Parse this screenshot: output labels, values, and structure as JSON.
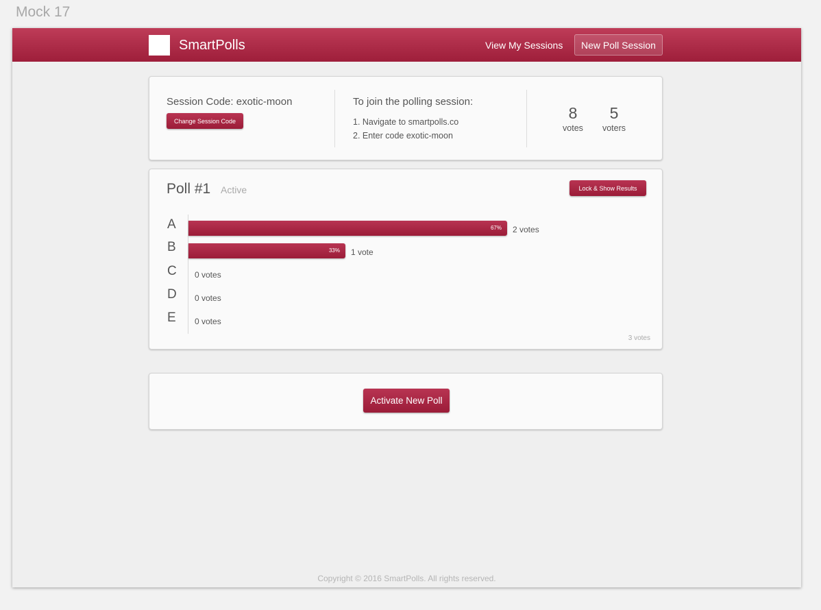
{
  "mock_label": "Mock 17",
  "navbar": {
    "brand": "SmartPolls",
    "view_sessions": "View My Sessions",
    "new_poll_session": "New Poll Session"
  },
  "session": {
    "code_label": "Session Code: exotic-moon",
    "change_button": "Change Session Code",
    "join_title": "To join the polling session:",
    "steps": [
      "1. Navigate to smartpolls.co",
      "2. Enter code exotic-moon"
    ],
    "stats": [
      {
        "value": "8",
        "label": "votes"
      },
      {
        "value": "5",
        "label": "voters"
      }
    ]
  },
  "poll": {
    "title": "Poll #1",
    "status": "Active",
    "lock_button": "Lock & Show Results",
    "options": [
      {
        "letter": "A",
        "percent": 67,
        "percent_label": "67%",
        "votes_label": "2 votes"
      },
      {
        "letter": "B",
        "percent": 33,
        "percent_label": "33%",
        "votes_label": "1 vote"
      },
      {
        "letter": "C",
        "percent": 0,
        "percent_label": "",
        "votes_label": "0 votes"
      },
      {
        "letter": "D",
        "percent": 0,
        "percent_label": "",
        "votes_label": "0 votes"
      },
      {
        "letter": "E",
        "percent": 0,
        "percent_label": "",
        "votes_label": "0 votes"
      }
    ],
    "total_votes": "3 votes"
  },
  "activate_button": "Activate New Poll",
  "footer": "Copyright © 2016 SmartPolls. All rights reserved.",
  "colors": {
    "brand": "#a82443",
    "background": "#efefef",
    "card": "#fafafa"
  }
}
